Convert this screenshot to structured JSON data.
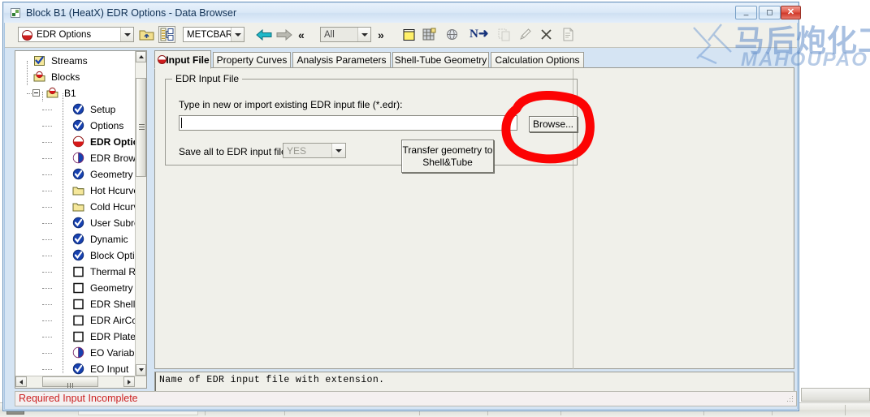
{
  "window": {
    "title": "Block B1 (HeatX) EDR Options - Data Browser",
    "icon": "app-icon",
    "controls": {
      "minimize": "–",
      "maximize": "▭",
      "close": "✕"
    }
  },
  "watermark": {
    "cn": "马后炮化工",
    "en": "MAHOUPAO"
  },
  "toolbar": {
    "form_combo": {
      "value": "EDR Options",
      "icon": "red-half-circle-icon"
    },
    "folder_up_button": "folder-up-icon",
    "split_view_button": "split-view-icon",
    "unit_combo": {
      "value": "METCBAR"
    },
    "back_button": "arrow-left-icon",
    "forward_button": "arrow-right-icon",
    "prev_chevrons": "«",
    "filter_combo": {
      "value": "All"
    },
    "next_chevrons": "»",
    "note_button": "note-icon",
    "grid_button": "grid-icon",
    "globe_button": "globe-icon",
    "next_input_button": "N➜",
    "copy_button": "copy-icon",
    "edit_button": "pencil-icon",
    "delete_button": "x-icon",
    "report_button": "report-icon"
  },
  "tree": {
    "items": [
      {
        "label": "Streams",
        "icon": "check-folder-icon",
        "indent": 0,
        "bold": false
      },
      {
        "label": "Blocks",
        "icon": "block-folder-icon",
        "indent": 0,
        "bold": false
      },
      {
        "label": "B1",
        "icon": "block-folder-icon",
        "indent": 1,
        "bold": false,
        "expander": "minus"
      },
      {
        "label": "Setup",
        "icon": "blue-check-icon",
        "indent": 2,
        "bold": false
      },
      {
        "label": "Options",
        "icon": "blue-check-icon",
        "indent": 2,
        "bold": false
      },
      {
        "label": "EDR Options",
        "icon": "red-half-icon",
        "indent": 2,
        "bold": true
      },
      {
        "label": "EDR Browser",
        "icon": "half-blue-icon",
        "indent": 2,
        "bold": false
      },
      {
        "label": "Geometry",
        "icon": "blue-check-icon",
        "indent": 2,
        "bold": false
      },
      {
        "label": "Hot Hcurves",
        "icon": "yellow-folder-icon",
        "indent": 2,
        "bold": false
      },
      {
        "label": "Cold Hcurves",
        "icon": "yellow-folder-icon",
        "indent": 2,
        "bold": false
      },
      {
        "label": "User Subroutine",
        "icon": "blue-check-icon",
        "indent": 2,
        "bold": false
      },
      {
        "label": "Dynamic",
        "icon": "blue-check-icon",
        "indent": 2,
        "bold": false
      },
      {
        "label": "Block Options",
        "icon": "blue-check-icon",
        "indent": 2,
        "bold": false
      },
      {
        "label": "Thermal Results",
        "icon": "empty-box-icon",
        "indent": 2,
        "bold": false
      },
      {
        "label": "Geometry",
        "icon": "empty-box-icon",
        "indent": 2,
        "bold": false
      },
      {
        "label": "EDR Shell&Tube",
        "icon": "empty-box-icon",
        "indent": 2,
        "bold": false
      },
      {
        "label": "EDR AirCooled",
        "icon": "empty-box-icon",
        "indent": 2,
        "bold": false
      },
      {
        "label": "EDR Plate",
        "icon": "empty-box-icon",
        "indent": 2,
        "bold": false
      },
      {
        "label": "EO Variables",
        "icon": "half-blue-icon",
        "indent": 2,
        "bold": false
      },
      {
        "label": "EO Input",
        "icon": "blue-check-icon",
        "indent": 2,
        "bold": false
      }
    ]
  },
  "tabs": [
    {
      "label": "Input File",
      "active": true,
      "icon": "red-half-circle-icon"
    },
    {
      "label": "Property Curves",
      "active": false
    },
    {
      "label": "Analysis Parameters",
      "active": false
    },
    {
      "label": "Shell-Tube Geometry",
      "active": false
    },
    {
      "label": "Calculation Options",
      "active": false
    }
  ],
  "form": {
    "group_title": "EDR  Input File",
    "type_label": "Type in new or import existing EDR input file (*.edr):",
    "file_input": {
      "value": "",
      "placeholder": ""
    },
    "browse_button": "Browse...",
    "save_label": "Save all to EDR input file:",
    "save_combo": {
      "value": "YES"
    },
    "transfer_button_line1": "Transfer geometry to",
    "transfer_button_line2": "Shell&Tube"
  },
  "help": {
    "text": "Name of EDR input file with extension."
  },
  "status": {
    "text": "Required Input Incomplete"
  },
  "colors": {
    "accent_red": "#cc2222",
    "annotation_red": "#fc0303",
    "panel_bg": "#f0f0ea",
    "titlebar_blue": "#d5e4f3",
    "watermark_blue": "#608cc8"
  }
}
